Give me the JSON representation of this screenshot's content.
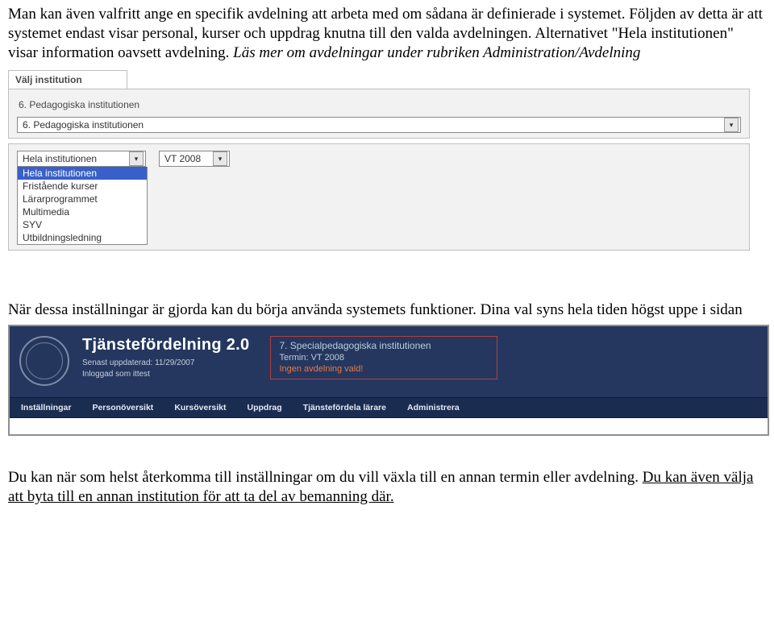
{
  "paragraphs": {
    "p1a": "Man kan även valfritt ange en specifik avdelning att arbeta med om sådana är definierade i systemet. Följden av detta är att systemet endast visar personal, kurser och uppdrag knutna till den valda avdelningen. Alternativet \"Hela institutionen\" visar information oavsett avdelning. ",
    "p1b": "Läs mer om avdelningar under rubriken Administration/Avdelning",
    "p2": "När dessa inställningar är gjorda kan du börja använda systemets funktioner. Dina val syns hela tiden högst uppe i sidan",
    "p3a": "Du kan när som helst återkomma till inställningar om du vill växla till en annan termin eller avdelning. ",
    "p3b": "Du kan även välja att byta till en annan institution för att ta del av bemanning där."
  },
  "panel1": {
    "section_title": "Välj institution",
    "step_label": "6. Pedagogiska institutionen",
    "dept_selected": "Hela institutionen",
    "term_selected": "VT 2008",
    "options": [
      "Hela institutionen",
      "Fristående kurser",
      "Lärarprogrammet",
      "Multimedia",
      "SYV",
      "Utbildningsledning"
    ]
  },
  "panel2": {
    "title": "Tjänstefördelning 2.0",
    "meta1": "Senast uppdaterad: 11/29/2007",
    "meta2": "Inloggad som ittest",
    "info1": "7. Specialpedagogiska institutionen",
    "info2": "Termin: VT 2008",
    "info3": "Ingen avdelning vald!",
    "menu": {
      "m0": "Inställningar",
      "m1": "Personöversikt",
      "m2": "Kursöversikt",
      "m3": "Uppdrag",
      "m4": "Tjänstefördela lärare",
      "m5": "Administrera"
    }
  }
}
